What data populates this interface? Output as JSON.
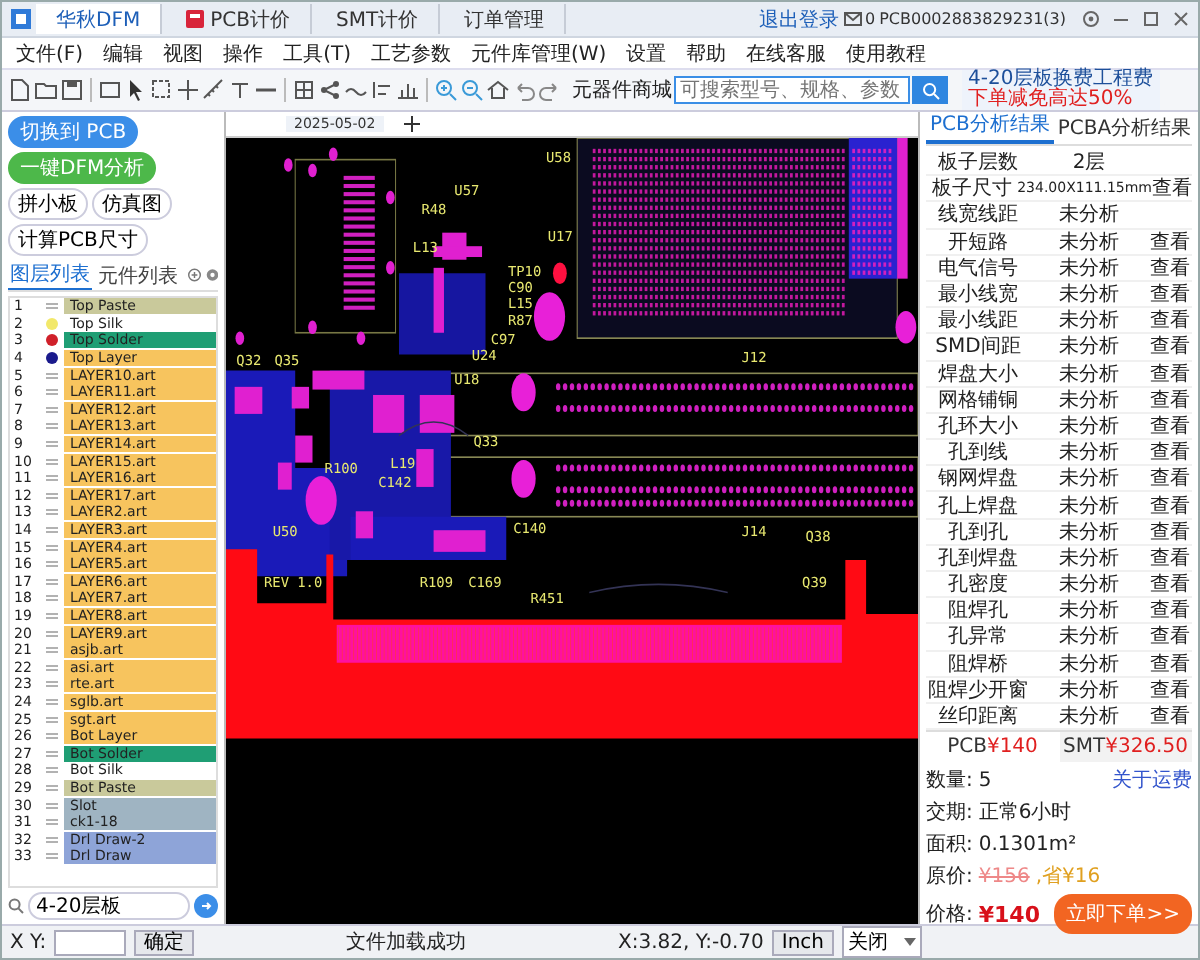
{
  "window": {
    "tabs": [
      {
        "label": "华秋DFM",
        "selected": true,
        "kind": "logo"
      },
      {
        "label": "PCB计价",
        "selected": false,
        "kind": "flag"
      },
      {
        "label": "SMT计价",
        "selected": false,
        "kind": "plain"
      },
      {
        "label": "订单管理",
        "selected": false,
        "kind": "plain"
      }
    ],
    "user_link": "退出登录",
    "message_count": "0",
    "account": "PCB0002883829231(3)"
  },
  "menu": [
    "文件(F)",
    "编辑",
    "视图",
    "操作",
    "工具(T)",
    "工艺参数",
    "元件库管理(W)",
    "设置",
    "帮助",
    "在线客服",
    "使用教程"
  ],
  "store_search": {
    "label": "元器件商城",
    "placeholder": "可搜索型号、规格、参数"
  },
  "promo": {
    "text": "4-20层板换费工程费",
    "highlight": "下单减免高达50%"
  },
  "left_panel": {
    "buttons": [
      "切换到 PCB",
      "一键DFM分析"
    ],
    "tools": [
      "拼小板",
      "仿真图",
      "计算PCB尺寸"
    ],
    "tabs": [
      {
        "label": "图层列表",
        "selected": true
      },
      {
        "label": "元件列表",
        "selected": false
      }
    ],
    "layers": [
      {
        "number": "1",
        "name": "Top Paste",
        "color": "#c9c99b"
      },
      {
        "number": "2",
        "name": "Top Silk",
        "color": "#ffffff",
        "marker": {
          "color": "#f2e86a"
        }
      },
      {
        "number": "3",
        "name": "Top Solder",
        "color": "#1f9e74",
        "marker": {
          "color": "#d0202a"
        }
      },
      {
        "number": "4",
        "name": "Top Layer",
        "color": "#f7c45e",
        "marker": {
          "color": "#1a1a8c"
        }
      },
      {
        "number": "5",
        "name": "LAYER10.art",
        "color": "#f7c45e"
      },
      {
        "number": "6",
        "name": "LAYER11.art",
        "color": "#f7c45e"
      },
      {
        "number": "7",
        "name": "LAYER12.art",
        "color": "#f7c45e"
      },
      {
        "number": "8",
        "name": "LAYER13.art",
        "color": "#f7c45e"
      },
      {
        "number": "9",
        "name": "LAYER14.art",
        "color": "#f7c45e"
      },
      {
        "number": "10",
        "name": "LAYER15.art",
        "color": "#f7c45e"
      },
      {
        "number": "11",
        "name": "LAYER16.art",
        "color": "#f7c45e"
      },
      {
        "number": "12",
        "name": "LAYER17.art",
        "color": "#f7c45e"
      },
      {
        "number": "13",
        "name": "LAYER2.art",
        "color": "#f7c45e"
      },
      {
        "number": "14",
        "name": "LAYER3.art",
        "color": "#f7c45e"
      },
      {
        "number": "15",
        "name": "LAYER4.art",
        "color": "#f7c45e"
      },
      {
        "number": "16",
        "name": "LAYER5.art",
        "color": "#f7c45e"
      },
      {
        "number": "17",
        "name": "LAYER6.art",
        "color": "#f7c45e"
      },
      {
        "number": "18",
        "name": "LAYER7.art",
        "color": "#f7c45e"
      },
      {
        "number": "19",
        "name": "LAYER8.art",
        "color": "#f7c45e"
      },
      {
        "number": "20",
        "name": "LAYER9.art",
        "color": "#f7c45e"
      },
      {
        "number": "21",
        "name": "asjb.art",
        "color": "#f7c45e"
      },
      {
        "number": "22",
        "name": "asi.art",
        "color": "#f7c45e"
      },
      {
        "number": "23",
        "name": "rte.art",
        "color": "#f7c45e"
      },
      {
        "number": "24",
        "name": "sglb.art",
        "color": "#f7c45e"
      },
      {
        "number": "25",
        "name": "sgt.art",
        "color": "#f7c45e"
      },
      {
        "number": "26",
        "name": "Bot Layer",
        "color": "#f7c45e"
      },
      {
        "number": "27",
        "name": "Bot Solder",
        "color": "#1f9e74"
      },
      {
        "number": "28",
        "name": "Bot Silk",
        "color": "#ffffff"
      },
      {
        "number": "29",
        "name": "Bot Paste",
        "color": "#c9c99b"
      },
      {
        "number": "30",
        "name": "Slot",
        "color": "#9fb4c2"
      },
      {
        "number": "31",
        "name": "ck1-18",
        "color": "#9fb4c2"
      },
      {
        "number": "32",
        "name": "Drl Draw-2",
        "color": "#8ea4d8"
      },
      {
        "number": "33",
        "name": "Drl Draw",
        "color": "#8ea4d8"
      }
    ],
    "command": {
      "value": "4-20层板"
    }
  },
  "canvas": {
    "tab": "2025-05-02",
    "labels": [
      "U58",
      "U57",
      "R48",
      "L13",
      "U17",
      "TP10",
      "C90",
      "L15",
      "R87",
      "C97",
      "U24",
      "U18",
      "J12",
      "J14",
      "Q32",
      "Q35",
      "Q33",
      "L19",
      "C142",
      "R100",
      "C140",
      "R109",
      "C169",
      "U50",
      "REV 1.0",
      "R451",
      "Q38",
      "Q39"
    ]
  },
  "right_panel": {
    "tabs": [
      {
        "label": "PCB分析结果",
        "selected": true
      },
      {
        "label": "PCBA分析结果",
        "selected": false
      }
    ],
    "rows": [
      {
        "label": "板子层数",
        "value": "2层"
      },
      {
        "label": "板子尺寸",
        "value": "234.00X111.15mm",
        "link": "查看"
      },
      {
        "label": "线宽线距",
        "value": "未分析"
      },
      {
        "label": "开短路",
        "value": "未分析",
        "link": "查看"
      },
      {
        "label": "电气信号",
        "value": "未分析",
        "link": "查看"
      },
      {
        "label": "最小线宽",
        "value": "未分析",
        "link": "查看"
      },
      {
        "label": "最小线距",
        "value": "未分析",
        "link": "查看"
      },
      {
        "label": "SMD间距",
        "value": "未分析",
        "link": "查看"
      },
      {
        "label": "焊盘大小",
        "value": "未分析",
        "link": "查看"
      },
      {
        "label": "网格铺铜",
        "value": "未分析",
        "link": "查看"
      },
      {
        "label": "孔环大小",
        "value": "未分析",
        "link": "查看"
      },
      {
        "label": "孔到线",
        "value": "未分析",
        "link": "查看"
      },
      {
        "label": "钢网焊盘",
        "value": "未分析",
        "link": "查看"
      },
      {
        "label": "孔上焊盘",
        "value": "未分析",
        "link": "查看"
      },
      {
        "label": "孔到孔",
        "value": "未分析",
        "link": "查看"
      },
      {
        "label": "孔到焊盘",
        "value": "未分析",
        "link": "查看"
      },
      {
        "label": "孔密度",
        "value": "未分析",
        "link": "查看"
      },
      {
        "label": "阻焊孔",
        "value": "未分析",
        "link": "查看"
      },
      {
        "label": "孔异常",
        "value": "未分析",
        "link": "查看"
      },
      {
        "label": "阻焊桥",
        "value": "未分析",
        "link": "查看"
      },
      {
        "label": "阻焊少开窗",
        "value": "未分析",
        "link": "查看"
      },
      {
        "label": "丝印距离",
        "value": "未分析",
        "link": "查看"
      }
    ],
    "price_tabs": [
      {
        "label": "PCB",
        "price": "¥140",
        "selected": true
      },
      {
        "label": "SMT",
        "price": "¥326.50",
        "selected": false
      }
    ],
    "quantity_label": "数量:",
    "quantity": "5",
    "shipping_link": "关于运费",
    "lead_label": "交期:",
    "lead": "正常6小时",
    "area_label": "面积:",
    "area": "0.1301m²",
    "original_label": "原价:",
    "original": "¥156",
    "saving": ",省¥16",
    "price_label": "价格:",
    "price": "¥140",
    "order_button": "立即下单>>"
  },
  "status_bar": {
    "xy_label": "X Y:",
    "confirm": "确定",
    "message": "文件加载成功",
    "coords": "X:3.82, Y:-0.70",
    "unit": "Inch",
    "mode": "关闭"
  }
}
